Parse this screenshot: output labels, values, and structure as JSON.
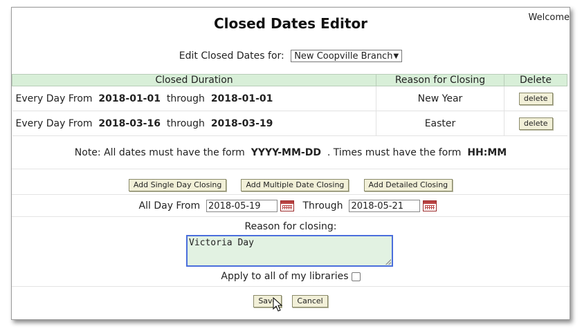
{
  "header": {
    "welcome": "Welcome",
    "title": "Closed Dates Editor"
  },
  "branch_select": {
    "label": "Edit Closed Dates for:",
    "value": "New Coopville Branch"
  },
  "table": {
    "headers": [
      "Closed Duration",
      "Reason for Closing",
      "Delete"
    ],
    "rows": [
      {
        "prefix": "Every Day From",
        "start": "2018-01-01",
        "through": "through",
        "end": "2018-01-01",
        "reason": "New Year",
        "delete": "delete"
      },
      {
        "prefix": "Every Day From",
        "start": "2018-03-16",
        "through": "through",
        "end": "2018-03-19",
        "reason": "Easter",
        "delete": "delete"
      }
    ]
  },
  "note": {
    "part1": "Note: All dates must have the form",
    "date_format": "YYYY-MM-DD",
    "part2": ". Times must have the form",
    "time_format": "HH:MM"
  },
  "add_buttons": {
    "single": "Add Single Day Closing",
    "multiple": "Add Multiple Date Closing",
    "detailed": "Add Detailed Closing"
  },
  "form": {
    "from_label": "All Day From",
    "from_value": "2018-05-19",
    "through_label": "Through",
    "through_value": "2018-05-21",
    "reason_label": "Reason for closing:",
    "reason_value": "Victoria Day",
    "apply_label": "Apply to all of my libraries",
    "save": "Save",
    "cancel": "Cancel"
  },
  "icons": {
    "calendar": "calendar-icon",
    "dropdown": "chevron-down-icon",
    "cursor": "mouse-pointer-icon"
  },
  "colors": {
    "table_header_bg": "#d8efd8",
    "button_bg": "#f2f0d8",
    "textarea_bg": "#e2f2e2",
    "textarea_border": "#4a6edc",
    "calendar_accent": "#b84242"
  }
}
